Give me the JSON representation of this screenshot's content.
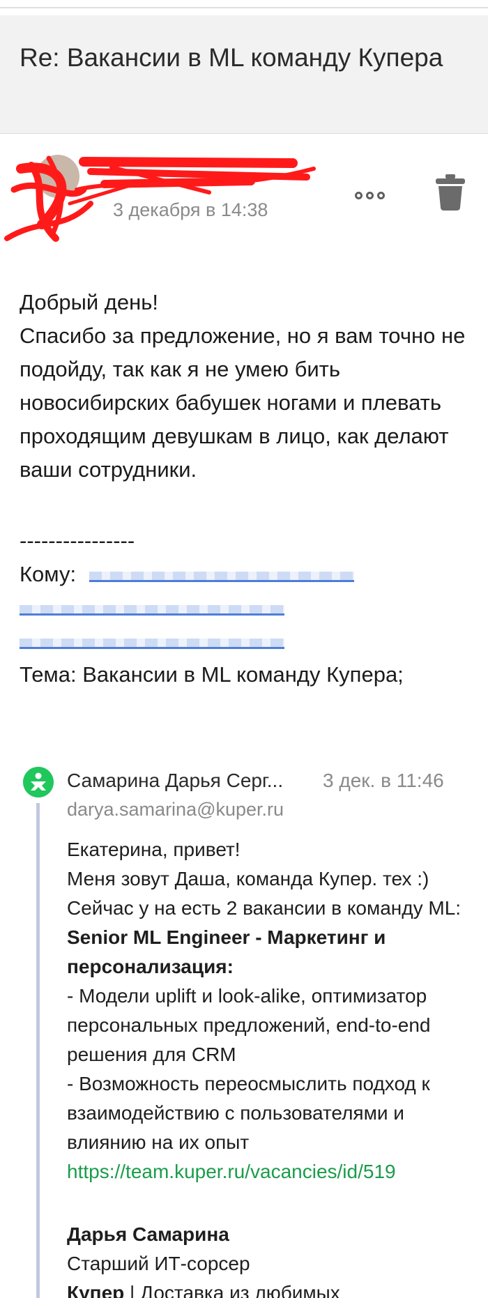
{
  "subject": {
    "title": "Re: Вакансии в ML команду Купера"
  },
  "sender": {
    "date": "3 декабря в 14:38"
  },
  "icons": {
    "more": "more-options-icon",
    "trash": "trash-icon",
    "logo": "kuper-logo-icon"
  },
  "body": {
    "greeting": "Добрый день!",
    "text": "Спасибо за предложение, но я вам точно не подойду, так как я не умею бить новосибирских бабушек ногами и плевать проходящим девушкам в лицо, как делают ваши сотрудники."
  },
  "quote_header": {
    "separator": "----------------",
    "to_label": "Кому:",
    "subject_line": "Тема: Вакансии в ML команду Купера;"
  },
  "quoted": {
    "sender_name": "Самарина Дарья Серг...",
    "date": "3 дек. в 11:46",
    "email": "darya.samarina@kuper.ru",
    "line1": "Екатерина, привет!",
    "line2": "Меня зовут Даша, команда Купер. тех :)",
    "line3": "Сейчас у на есть 2 вакансии в команду ML:",
    "vacancy_title": "Senior ML Engineer - Маркетинг и персонализация:",
    "bullet1": "- Модели uplift и look-alike, оптимизатор персональных предложений, end-to-end решения для CRM",
    "bullet2": "- Возможность переосмыслить подход к взаимодействию с пользователями и влиянию на их опыт",
    "link": "https://team.kuper.ru/vacancies/id/519"
  },
  "signature": {
    "name": "Дарья Самарина",
    "role": "Старший ИТ-сорсер",
    "company": "Купер",
    "tagline": " | Доставка из любимых"
  },
  "colors": {
    "link_green": "#1a9c4a",
    "logo_green": "#1fc75d",
    "redaction": "#ff1a1a"
  }
}
